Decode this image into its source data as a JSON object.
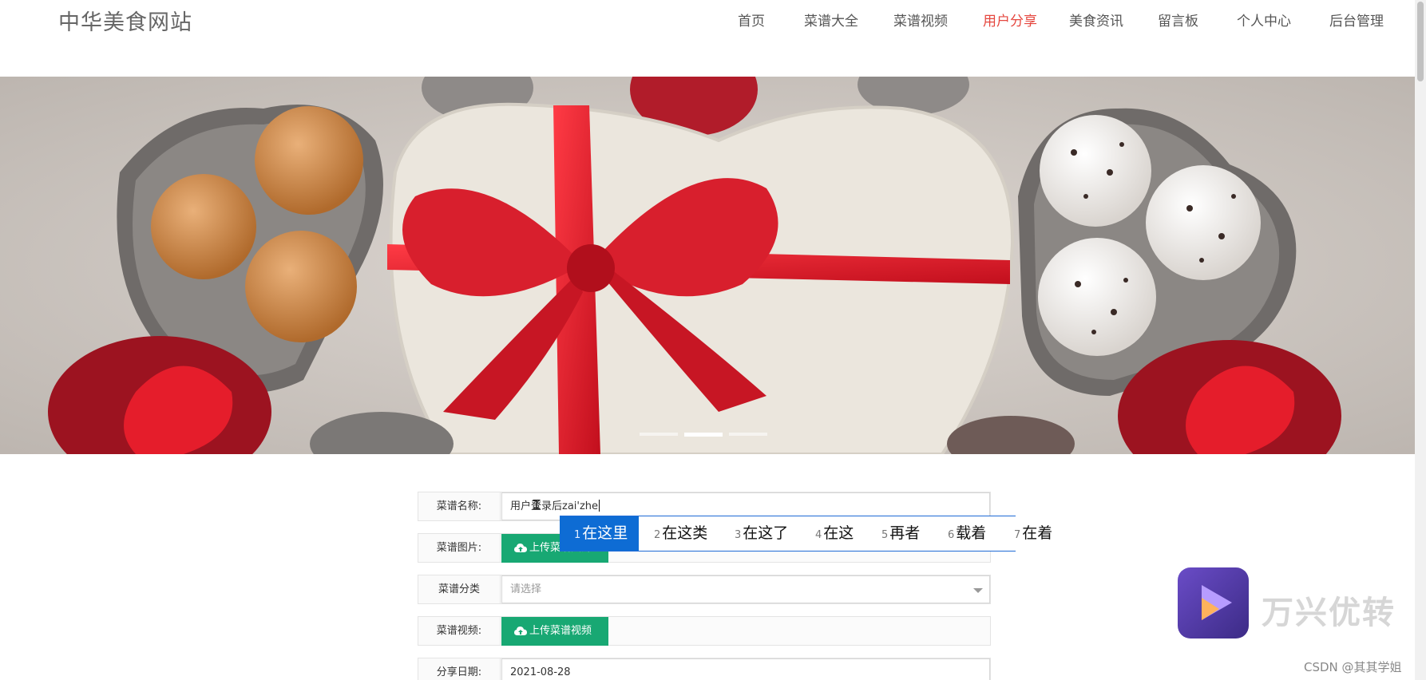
{
  "header": {
    "logo": "中华美食网站",
    "nav": [
      {
        "label": "首页",
        "active": false
      },
      {
        "label": "菜谱大全",
        "active": false
      },
      {
        "label": "菜谱视频",
        "active": false
      },
      {
        "label": "用户分享",
        "active": true
      },
      {
        "label": "美食资讯",
        "active": false
      },
      {
        "label": "留言板",
        "active": false
      },
      {
        "label": "个人中心",
        "active": false
      },
      {
        "label": "后台管理",
        "active": false
      }
    ]
  },
  "carousel": {
    "slide_count": 3,
    "active_index": 1
  },
  "form": {
    "name_label": "菜谱名称:",
    "name_value": "用户登录后zai'zhe",
    "image_label": "菜谱图片:",
    "image_button": "上传菜谱图片",
    "category_label": "菜谱分类",
    "category_placeholder": "请选择",
    "video_label": "菜谱视频:",
    "video_button": "上传菜谱视频",
    "date_label": "分享日期:",
    "date_value": "2021-08-28"
  },
  "ime": {
    "candidates": [
      {
        "num": "1",
        "text": "在这里",
        "selected": true
      },
      {
        "num": "2",
        "text": "在这类",
        "selected": false
      },
      {
        "num": "3",
        "text": "在这了",
        "selected": false
      },
      {
        "num": "4",
        "text": "在这",
        "selected": false
      },
      {
        "num": "5",
        "text": "再者",
        "selected": false
      },
      {
        "num": "6",
        "text": "载着",
        "selected": false
      },
      {
        "num": "7",
        "text": "在着",
        "selected": false
      }
    ]
  },
  "watermark": {
    "brand_text": "万兴优转",
    "credit": "CSDN @其其学姐"
  },
  "colors": {
    "accent_red": "#e5473f",
    "upload_green": "#18a873",
    "ime_blue": "#0e6cd4"
  }
}
